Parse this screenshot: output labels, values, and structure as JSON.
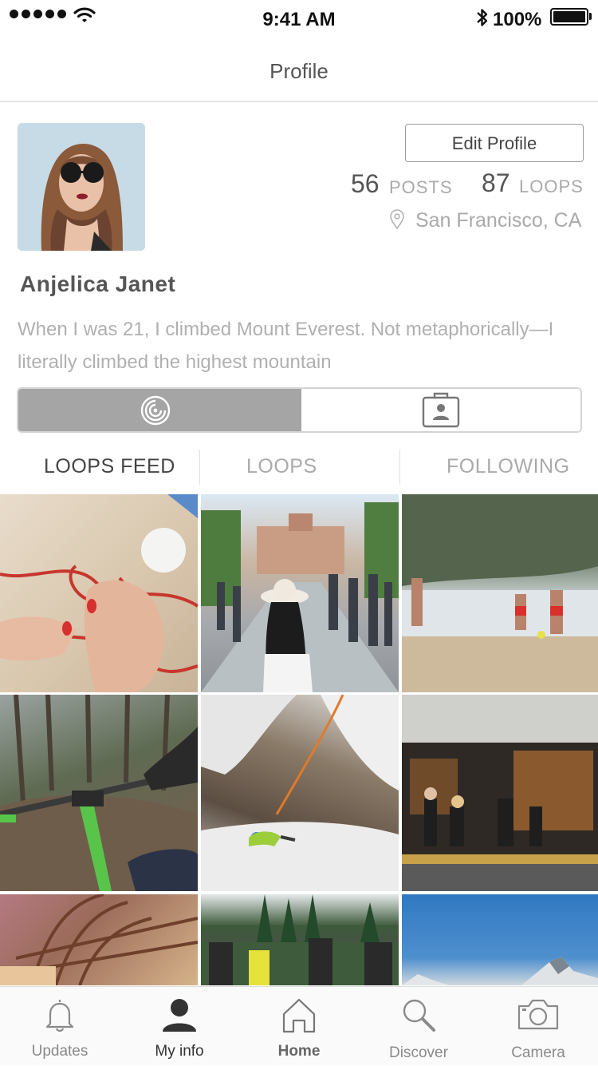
{
  "status_bar": {
    "time": "9:41 AM",
    "battery": "100%"
  },
  "nav": {
    "title": "Profile"
  },
  "profile": {
    "name": "Anjelica Janet",
    "edit_label": "Edit Profile",
    "posts_count": "56",
    "posts_label": "POSTS",
    "loops_count": "87",
    "loops_label": "LOOPS",
    "location": "San Francisco, CA",
    "bio": "When I was 21, I climbed Mount Everest. Not metaphorically—I literally climbed the highest mountain"
  },
  "segmented": {
    "selected": "loops-view",
    "icons": [
      "spiral-icon",
      "profile-card-icon"
    ]
  },
  "subtabs": [
    "LOOPS FEED",
    "LOOPS",
    "FOLLOWING"
  ],
  "photos": [
    "knitting",
    "city-street",
    "beach-football",
    "mountain-bike",
    "rock-climbing",
    "cafe",
    "basket",
    "rugby",
    "mountain-sky"
  ],
  "tabbar": [
    {
      "label": "Updates",
      "icon": "bell-icon"
    },
    {
      "label": "My info",
      "icon": "person-icon"
    },
    {
      "label": "Home",
      "icon": "home-icon"
    },
    {
      "label": "Discover",
      "icon": "search-icon"
    },
    {
      "label": "Camera",
      "icon": "camera-icon"
    }
  ]
}
